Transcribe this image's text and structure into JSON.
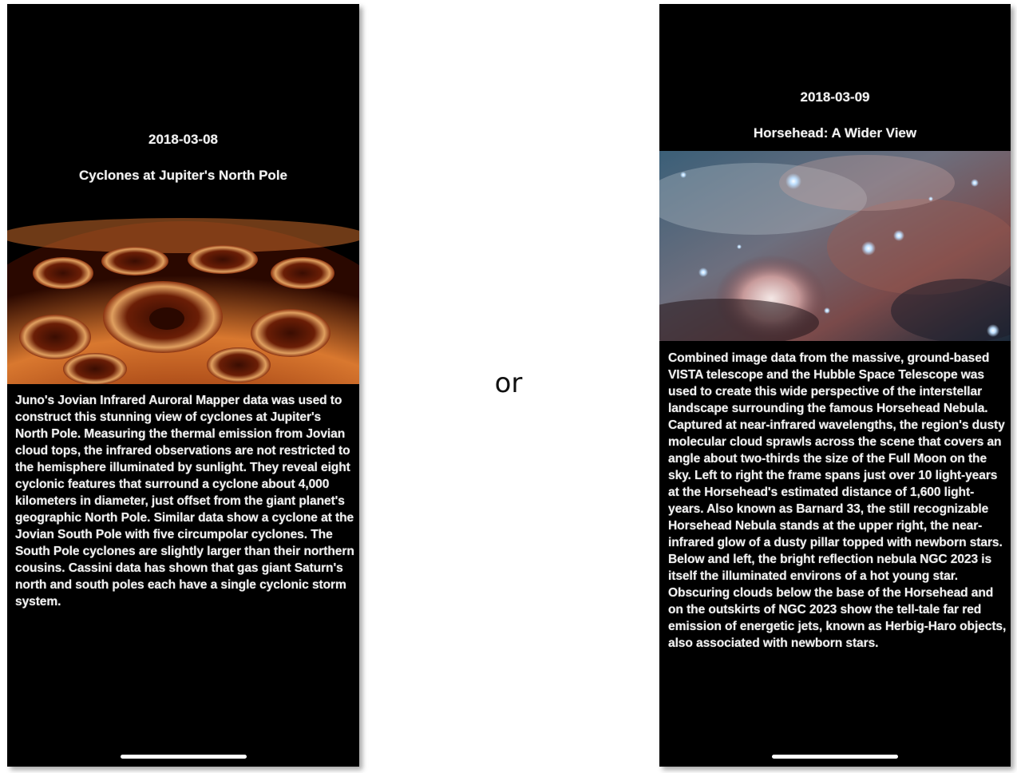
{
  "separator": "or",
  "screens": [
    {
      "date": "2018-03-08",
      "title": "Cyclones at Jupiter's North Pole",
      "image_subject": "Jupiter north pole infrared cyclones",
      "explanation": "Juno's Jovian Infrared Auroral Mapper data was used to construct this stunning view of cyclones at Jupiter's North Pole. Measuring the thermal emission from Jovian cloud tops, the infrared observations are not restricted to the hemisphere illuminated by sunlight. They reveal eight cyclonic features that surround a cyclone about 4,000 kilometers in diameter, just offset from the giant planet's geographic North Pole. Similar data show a cyclone at the Jovian South Pole with five circumpolar cyclones. The South Pole cyclones are slightly larger than their northern cousins. Cassini data has shown that gas giant Saturn's north and south poles each have a single cyclonic storm system."
    },
    {
      "date": "2018-03-09",
      "title": "Horsehead: A Wider View",
      "image_subject": "Horsehead Nebula wide field",
      "explanation": "Combined image data from the massive, ground-based VISTA telescope and the Hubble Space Telescope was used to create this wide perspective of the interstellar landscape surrounding the famous Horsehead Nebula. Captured at near-infrared wavelengths, the region's dusty molecular cloud sprawls across the scene that covers an angle about two-thirds the size of the Full Moon on the sky. Left to right the frame spans just over 10 light-years at the Horsehead's estimated distance of 1,600 light-years. Also known as Barnard 33, the still recognizable Horsehead Nebula stands at the upper right, the near-infrared glow of a dusty pillar topped with newborn stars. Below and left, the bright reflection nebula NGC 2023 is itself the illuminated environs of a hot young star. Obscuring clouds below the base of the Horsehead and on the outskirts of NGC 2023 show the tell-tale far red emission of energetic jets, known as Herbig-Haro objects, also associated with newborn stars."
    }
  ],
  "colors": {
    "screen_background": "#000000",
    "text": "#f0f0f0",
    "home_indicator": "#ffffff"
  }
}
